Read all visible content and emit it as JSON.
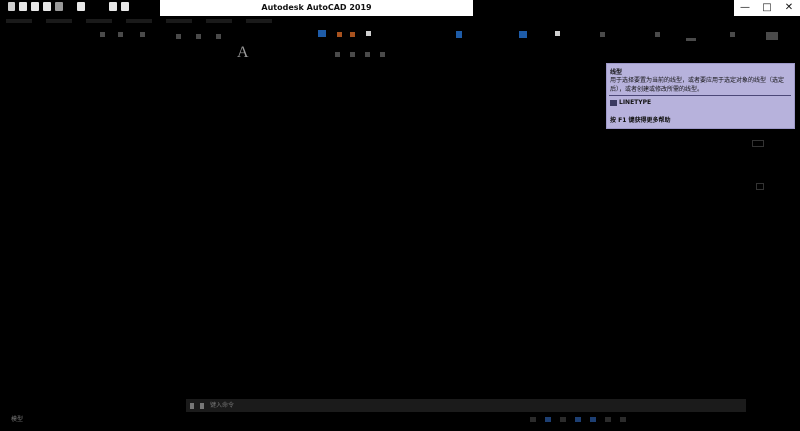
{
  "window": {
    "title": "Autodesk AutoCAD 2019",
    "minimize_glyph": "—",
    "maximize_glyph": "□",
    "close_glyph": "✕"
  },
  "ribbon": {
    "text_tool_glyph": "A"
  },
  "tooltip": {
    "title": "线型",
    "description": "用于选择要置为当前的线型，或者要应用于选定对象的线型（选定后），或者创建或修改所需的线型。",
    "command_icon": "linetype-icon",
    "command": "LINETYPE",
    "help": "按 F1 键获得更多帮助"
  },
  "command_line": {
    "placeholder": "键入命令"
  },
  "status": {
    "model_label": "模型"
  },
  "colors": {
    "background": "#000000",
    "tooltip_bg": "#b7b2dc",
    "status_accent": "#1d3f73"
  }
}
